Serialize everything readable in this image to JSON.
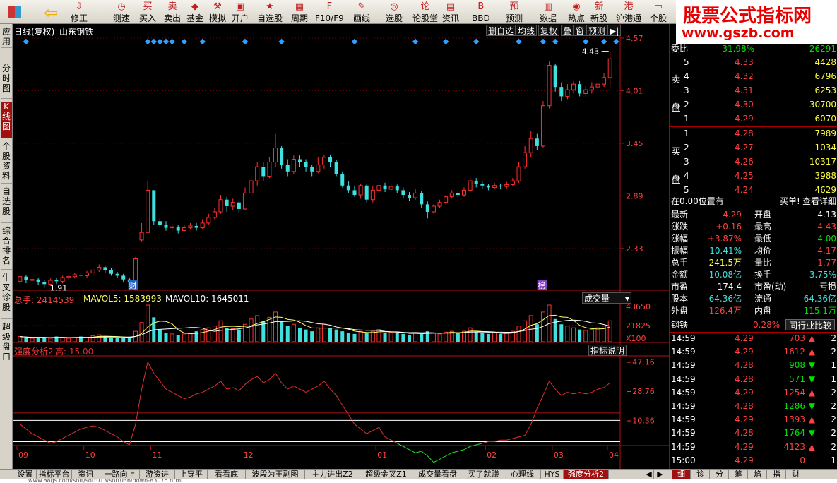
{
  "toolbar": {
    "buttons": [
      {
        "label": "修正",
        "icon": "arrow-down-icon"
      },
      {
        "label": "测速",
        "icon": "clock-icon"
      },
      {
        "label": "买入",
        "icon": "buy-icon"
      },
      {
        "label": "卖出",
        "icon": "sell-icon"
      },
      {
        "label": "基金",
        "icon": "fund-icon"
      },
      {
        "label": "模拟",
        "icon": "hammer-icon"
      },
      {
        "label": "开户",
        "icon": "open-account-icon"
      },
      {
        "label": "自选股",
        "icon": "watchlist-icon"
      },
      {
        "label": "周期",
        "icon": "calendar-icon"
      },
      {
        "label": "F10/F9",
        "icon": "f10-icon"
      },
      {
        "label": "画线",
        "icon": "pencil-icon"
      },
      {
        "label": "选股",
        "icon": "stock-picker-icon"
      },
      {
        "label": "论股堂",
        "icon": "forum-icon"
      },
      {
        "label": "资讯",
        "icon": "news-icon"
      },
      {
        "label": "BBD",
        "icon": "bbd-icon"
      },
      {
        "label": "预测",
        "icon": "forecast-icon"
      },
      {
        "label": "数据",
        "icon": "data-icon"
      },
      {
        "label": "热点",
        "icon": "hotspot-icon"
      },
      {
        "label": "新股",
        "icon": "ipo-icon"
      },
      {
        "label": "沪港通",
        "icon": "hk-connect-icon"
      },
      {
        "label": "个股",
        "icon": "stock-icon"
      }
    ]
  },
  "banner": {
    "line1": "股票公式指标网",
    "line2": "www.gszb.com"
  },
  "left_tabs": [
    "应用",
    "分时图",
    "K线图",
    "个股资料",
    "自选股",
    "综合排名",
    "牛叉诊股",
    "超级盘口"
  ],
  "chart": {
    "header_title": "日线(复权)",
    "stock_name": "山东钢铁",
    "right_buttons": [
      "删自选",
      "均线",
      "复权",
      "叠",
      "窗",
      "预测",
      "▶|"
    ],
    "price_axis": [
      "4.57",
      "4.01",
      "3.45",
      "2.89",
      "2.33"
    ],
    "high_label": "4.43",
    "low_label": "1.91",
    "marker_cai": "财",
    "marker_bang": "榜",
    "volume": {
      "total_label": "总手: 2414539",
      "mavol5": "MAVOL5: 1583993",
      "mavol10": "MAVOL10: 1645011",
      "dropdown": "成交量",
      "axis": [
        "43650",
        "21825",
        "X100"
      ]
    },
    "indicator": {
      "title": "强度分析2",
      "high_label": "高: 15.00",
      "button": "指标说明",
      "axis": [
        "+47.16",
        "+28.76",
        "+10.36"
      ]
    },
    "months": [
      "09",
      "10",
      "11",
      "12",
      "01",
      "02",
      "03",
      "04"
    ]
  },
  "chart_data": {
    "type": "candlestick",
    "y_range": [
      1.9,
      4.57
    ],
    "candles": [
      [
        1.98,
        2.03,
        2.05,
        1.95
      ],
      [
        2.03,
        1.99,
        2.05,
        1.96
      ],
      [
        1.99,
        2.0,
        2.03,
        1.96
      ],
      [
        2.0,
        1.97,
        2.02,
        1.94
      ],
      [
        1.97,
        1.95,
        1.99,
        1.91
      ],
      [
        1.95,
        1.99,
        2.01,
        1.93
      ],
      [
        1.99,
        1.98,
        2.02,
        1.95
      ],
      [
        1.98,
        2.02,
        2.04,
        1.96
      ],
      [
        2.02,
        2.03,
        2.05,
        2.0
      ],
      [
        2.03,
        2.05,
        2.07,
        2.01
      ],
      [
        2.05,
        2.04,
        2.07,
        2.02
      ],
      [
        2.04,
        2.07,
        2.09,
        2.02
      ],
      [
        2.07,
        2.1,
        2.12,
        2.05
      ],
      [
        2.1,
        2.13,
        2.16,
        2.08
      ],
      [
        2.13,
        2.1,
        2.15,
        2.07
      ],
      [
        2.1,
        2.06,
        2.12,
        2.04
      ],
      [
        2.06,
        2.04,
        2.08,
        2.02
      ],
      [
        2.04,
        2.0,
        2.06,
        1.97
      ],
      [
        2.0,
        1.97,
        2.02,
        1.94
      ],
      [
        1.97,
        2.22,
        2.24,
        1.97
      ],
      [
        2.42,
        2.5,
        2.6,
        2.4
      ],
      [
        2.5,
        2.95,
        3.05,
        2.5
      ],
      [
        2.95,
        2.62,
        2.95,
        2.58
      ],
      [
        2.62,
        2.58,
        2.65,
        2.55
      ],
      [
        2.58,
        2.55,
        2.62,
        2.52
      ],
      [
        2.55,
        2.56,
        2.6,
        2.5
      ],
      [
        2.56,
        2.52,
        2.58,
        2.49
      ],
      [
        2.52,
        2.55,
        2.58,
        2.5
      ],
      [
        2.55,
        2.57,
        2.6,
        2.53
      ],
      [
        2.57,
        2.55,
        2.6,
        2.52
      ],
      [
        2.55,
        2.6,
        2.64,
        2.54
      ],
      [
        2.6,
        2.66,
        2.7,
        2.58
      ],
      [
        2.66,
        2.72,
        2.76,
        2.64
      ],
      [
        2.72,
        2.85,
        2.9,
        2.7
      ],
      [
        2.85,
        2.78,
        2.88,
        2.72
      ],
      [
        2.78,
        2.82,
        2.86,
        2.74
      ],
      [
        2.82,
        2.75,
        2.84,
        2.7
      ],
      [
        2.75,
        2.92,
        2.98,
        2.74
      ],
      [
        2.92,
        3.05,
        3.1,
        2.9
      ],
      [
        3.05,
        3.2,
        3.25,
        3.0
      ],
      [
        3.2,
        3.1,
        3.25,
        3.05
      ],
      [
        3.1,
        3.25,
        3.3,
        3.08
      ],
      [
        3.25,
        3.4,
        3.55,
        3.2
      ],
      [
        3.4,
        3.22,
        3.42,
        3.18
      ],
      [
        3.22,
        3.15,
        3.28,
        3.1
      ],
      [
        3.15,
        3.28,
        3.32,
        3.12
      ],
      [
        3.28,
        3.25,
        3.32,
        3.2
      ],
      [
        3.25,
        3.2,
        3.28,
        3.15
      ],
      [
        3.2,
        3.15,
        3.22,
        3.1
      ],
      [
        3.15,
        3.22,
        3.3,
        3.13
      ],
      [
        3.22,
        3.3,
        3.33,
        3.18
      ],
      [
        3.3,
        3.25,
        3.33,
        3.2
      ],
      [
        3.25,
        3.12,
        3.27,
        3.1
      ],
      [
        3.12,
        3.0,
        3.15,
        2.98
      ],
      [
        3.0,
        2.95,
        3.05,
        2.92
      ],
      [
        2.95,
        2.9,
        3.0,
        2.88
      ],
      [
        2.9,
        3.0,
        3.02,
        2.86
      ],
      [
        3.0,
        2.85,
        3.02,
        2.82
      ],
      [
        2.85,
        2.95,
        3.0,
        2.82
      ],
      [
        2.95,
        3.0,
        3.04,
        2.92
      ],
      [
        3.0,
        2.96,
        3.03,
        2.93
      ],
      [
        2.96,
        2.99,
        3.02,
        2.94
      ],
      [
        2.99,
        2.95,
        3.01,
        2.92
      ],
      [
        2.95,
        2.9,
        2.98,
        2.86
      ],
      [
        2.9,
        2.87,
        2.93,
        2.84
      ],
      [
        2.87,
        2.92,
        2.96,
        2.85
      ],
      [
        2.92,
        2.8,
        2.94,
        2.76
      ],
      [
        2.8,
        2.72,
        2.83,
        2.65
      ],
      [
        2.72,
        2.78,
        2.8,
        2.7
      ],
      [
        2.78,
        2.82,
        2.85,
        2.76
      ],
      [
        2.82,
        2.88,
        2.9,
        2.8
      ],
      [
        2.88,
        2.92,
        2.95,
        2.86
      ],
      [
        2.92,
        2.9,
        2.94,
        2.87
      ],
      [
        2.9,
        2.95,
        2.98,
        2.88
      ],
      [
        2.95,
        3.05,
        3.1,
        2.93
      ],
      [
        3.05,
        3.02,
        3.08,
        2.98
      ],
      [
        3.02,
        3.0,
        3.05,
        2.97
      ],
      [
        3.0,
        2.98,
        3.02,
        2.95
      ],
      [
        2.98,
        3.0,
        3.03,
        2.96
      ],
      [
        3.0,
        2.99,
        3.02,
        2.96
      ],
      [
        2.99,
        3.01,
        3.04,
        2.97
      ],
      [
        3.01,
        3.05,
        3.08,
        2.99
      ],
      [
        3.05,
        3.2,
        3.25,
        3.03
      ],
      [
        3.2,
        3.35,
        3.42,
        3.18
      ],
      [
        3.35,
        3.5,
        3.58,
        3.3
      ],
      [
        3.5,
        3.42,
        3.55,
        3.38
      ],
      [
        3.42,
        3.85,
        3.9,
        3.4
      ],
      [
        3.85,
        4.28,
        4.32,
        3.82
      ],
      [
        4.28,
        4.05,
        4.3,
        4.0
      ],
      [
        4.05,
        3.95,
        4.1,
        3.9
      ],
      [
        3.95,
        4.02,
        4.08,
        3.92
      ],
      [
        4.02,
        4.08,
        4.12,
        3.98
      ],
      [
        4.08,
        3.98,
        4.12,
        3.95
      ],
      [
        3.98,
        4.02,
        4.06,
        3.94
      ],
      [
        4.02,
        4.05,
        4.1,
        3.98
      ],
      [
        4.05,
        4.08,
        4.15,
        4.0
      ],
      [
        4.08,
        4.15,
        4.2,
        4.05
      ],
      [
        4.15,
        4.35,
        4.43,
        4.05
      ]
    ],
    "volume_range": [
      0,
      43650
    ],
    "volume": [
      6,
      5,
      4,
      5,
      5,
      4,
      6,
      5,
      4,
      5,
      6,
      5,
      7,
      8,
      6,
      5,
      4,
      5,
      4,
      12,
      22,
      42,
      28,
      14,
      10,
      9,
      8,
      9,
      10,
      12,
      14,
      16,
      18,
      24,
      16,
      15,
      14,
      20,
      26,
      30,
      24,
      28,
      34,
      24,
      18,
      20,
      16,
      14,
      12,
      16,
      20,
      16,
      14,
      12,
      10,
      9,
      12,
      10,
      12,
      14,
      10,
      11,
      10,
      9,
      8,
      10,
      9,
      12,
      10,
      9,
      11,
      12,
      10,
      12,
      16,
      11,
      10,
      9,
      10,
      9,
      10,
      12,
      18,
      24,
      30,
      20,
      34,
      42,
      26,
      20,
      18,
      16,
      14,
      13,
      14,
      16,
      18,
      24
    ],
    "indicator_range": [
      -5,
      50
    ],
    "indicator": [
      8,
      5,
      2,
      0,
      -2,
      -4,
      -3,
      -1,
      1,
      3,
      5,
      6,
      7,
      6,
      4,
      2,
      0,
      -3,
      -5,
      8,
      30,
      47,
      40,
      35,
      30,
      28,
      26,
      24,
      25,
      27,
      28,
      30,
      32,
      35,
      30,
      31,
      29,
      33,
      36,
      38,
      34,
      36,
      40,
      34,
      30,
      32,
      30,
      28,
      30,
      32,
      35,
      30,
      26,
      20,
      14,
      8,
      5,
      2,
      4,
      6,
      0,
      -2,
      -4,
      -6,
      -8,
      -10,
      -9,
      -12,
      -16,
      -14,
      -12,
      -10,
      -9,
      -8,
      -6,
      -5,
      -4,
      -3,
      -3,
      -2,
      -2,
      -1,
      0,
      1,
      8,
      18,
      26,
      35,
      30,
      26,
      28,
      27,
      28,
      27,
      28,
      30,
      31,
      34
    ],
    "indicator_lines": [
      10.36,
      6
    ]
  },
  "panel": {
    "weibi_label": "委比",
    "weibi_pct": "-31.98%",
    "weibi_diff": "-26291",
    "sell_label": "卖盘",
    "buy_label": "买盘",
    "sell": [
      {
        "lvl": "5",
        "price": "4.33",
        "vol": "4428"
      },
      {
        "lvl": "4",
        "price": "4.32",
        "vol": "6796"
      },
      {
        "lvl": "3",
        "price": "4.31",
        "vol": "6253"
      },
      {
        "lvl": "2",
        "price": "4.30",
        "vol": "30700"
      },
      {
        "lvl": "1",
        "price": "4.29",
        "vol": "6070"
      }
    ],
    "buy": [
      {
        "lvl": "1",
        "price": "4.28",
        "vol": "7989"
      },
      {
        "lvl": "2",
        "price": "4.27",
        "vol": "1034"
      },
      {
        "lvl": "3",
        "price": "4.26",
        "vol": "10317"
      },
      {
        "lvl": "4",
        "price": "4.25",
        "vol": "3988"
      },
      {
        "lvl": "5",
        "price": "4.24",
        "vol": "4629"
      }
    ],
    "position_note": "在0.00位置有",
    "buy_detail": "买单!",
    "view_detail": "查看详细",
    "quote": [
      {
        "l1": "最新",
        "v1": "4.29",
        "c1": "red",
        "l2": "开盘",
        "v2": "4.13",
        "c2": "white"
      },
      {
        "l1": "涨跌",
        "v1": "+0.16",
        "c1": "red",
        "l2": "最高",
        "v2": "4.43",
        "c2": "red"
      },
      {
        "l1": "涨幅",
        "v1": "+3.87%",
        "c1": "red",
        "l2": "最低",
        "v2": "4.00",
        "c2": "green"
      },
      {
        "l1": "振幅",
        "v1": "10.41%",
        "c1": "cyan",
        "l2": "均价",
        "v2": "4.17",
        "c2": "red"
      },
      {
        "l1": "总手",
        "v1": "241.5万",
        "c1": "yellow",
        "l2": "量比",
        "v2": "1.77",
        "c2": "red"
      },
      {
        "l1": "金额",
        "v1": "10.08亿",
        "c1": "cyan",
        "l2": "换手",
        "v2": "3.75%",
        "c2": "cyan"
      },
      {
        "l1": "市盈",
        "v1": "174.4",
        "c1": "white",
        "l2": "市盈(动)",
        "v2": "亏损",
        "c2": "white"
      },
      {
        "l1": "股本",
        "v1": "64.36亿",
        "c1": "cyan",
        "l2": "流通",
        "v2": "64.36亿",
        "c2": "cyan"
      },
      {
        "l1": "外盘",
        "v1": "126.4万",
        "c1": "red",
        "l2": "内盘",
        "v2": "115.1万",
        "c2": "green"
      }
    ],
    "sector_name": "钢铁",
    "sector_pct": "0.28%",
    "sector_button": "同行业比较",
    "ticks": [
      {
        "t": "14:59",
        "p": "4.29",
        "pc": "red",
        "v": "703",
        "d": "up",
        "n": "2"
      },
      {
        "t": "14:59",
        "p": "4.29",
        "pc": "red",
        "v": "1612",
        "d": "up",
        "n": "2"
      },
      {
        "t": "14:59",
        "p": "4.28",
        "pc": "red",
        "v": "908",
        "d": "down",
        "n": "1"
      },
      {
        "t": "14:59",
        "p": "4.28",
        "pc": "red",
        "v": "571",
        "d": "down",
        "n": "1"
      },
      {
        "t": "14:59",
        "p": "4.29",
        "pc": "red",
        "v": "1254",
        "d": "up",
        "n": "2"
      },
      {
        "t": "14:59",
        "p": "4.28",
        "pc": "red",
        "v": "1286",
        "d": "down",
        "n": "2"
      },
      {
        "t": "14:59",
        "p": "4.29",
        "pc": "red",
        "v": "1393",
        "d": "up",
        "n": "2"
      },
      {
        "t": "14:59",
        "p": "4.28",
        "pc": "red",
        "v": "1764",
        "d": "down",
        "n": "2"
      },
      {
        "t": "14:59",
        "p": "4.29",
        "pc": "red",
        "v": "4123",
        "d": "up",
        "n": "2"
      },
      {
        "t": "15:00",
        "p": "4.29",
        "pc": "red",
        "v": "0",
        "d": "",
        "n": "1"
      }
    ]
  },
  "bottom_tabs": [
    "设置",
    "指标平台",
    "资讯",
    "一路向上",
    "游资进",
    "上穿平",
    "看看底",
    "波段为王副图",
    "主力进出Z2",
    "超级金叉Z1",
    "成交量看盘",
    "买了就赚",
    "心理线",
    "HYS",
    "强度分析2"
  ],
  "bottom_right_tabs": [
    "细",
    "诊",
    "分",
    "筹",
    "焰",
    "指",
    "财"
  ],
  "status_url": "www.88gs.com/soft/sort013/sort036/down-83075.html"
}
